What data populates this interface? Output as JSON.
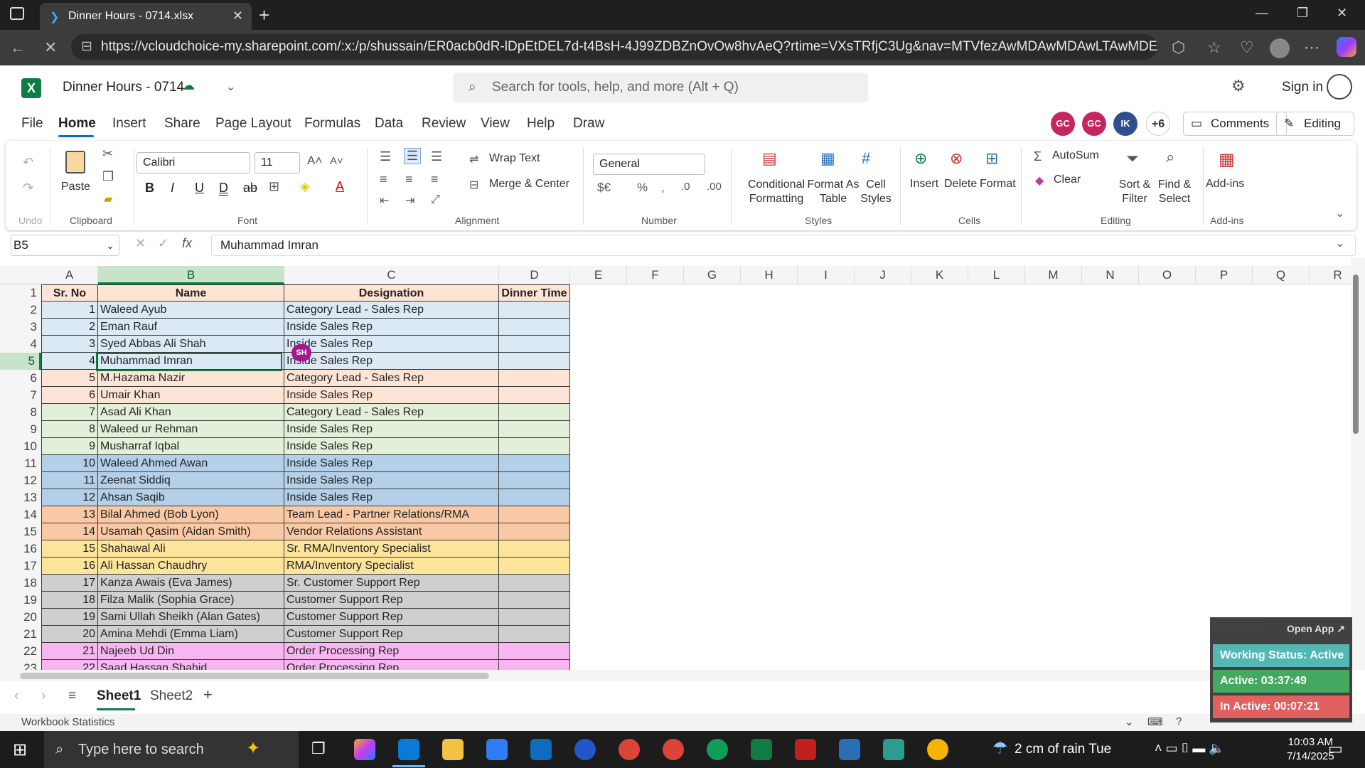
{
  "browser": {
    "tab_title": "Dinner Hours - 0714.xlsx",
    "url": "https://vcloudchoice-my.sharepoint.com/:x:/p/shussain/ER0acb0dR-lDpEtDEL7d-t4BsH-4J99ZDBZnOvOw8hvAeQ?rtime=VXsTRfjC3Ug&nav=MTVfezAwMDAwMDAwLTAwMDEtMDA..."
  },
  "excel": {
    "doc_title": "Dinner Hours - 0714",
    "search_placeholder": "Search for tools, help, and more (Alt + Q)",
    "sign_in": "Sign in",
    "menu": [
      "File",
      "Home",
      "Insert",
      "Share",
      "Page Layout",
      "Formulas",
      "Data",
      "Review",
      "View",
      "Help",
      "Draw"
    ],
    "avatars": [
      {
        "label": "GC",
        "color": "#c4265e"
      },
      {
        "label": "GC",
        "color": "#c4265e"
      },
      {
        "label": "IK",
        "color": "#2d4f8f"
      }
    ],
    "more_count": "+6",
    "comments_label": "Comments",
    "editing_label": "Editing",
    "ribbon": {
      "undo_group": "Undo",
      "clipboard_group": "Clipboard",
      "paste_label": "Paste",
      "font_group": "Font",
      "font_name": "Calibri",
      "font_size": "11",
      "alignment_group": "Alignment",
      "wrap_text": "Wrap Text",
      "merge_center": "Merge & Center",
      "number_group": "Number",
      "number_format": "General",
      "styles_group": "Styles",
      "conditional_formatting": [
        "Conditional",
        "Formatting"
      ],
      "format_as_table": [
        "Format As",
        "Table"
      ],
      "cell_styles": [
        "Cell",
        "Styles"
      ],
      "cells_group": "Cells",
      "insert": "Insert",
      "delete": "Delete",
      "format": "Format",
      "editing_group": "Editing",
      "autosum": "AutoSum",
      "clear": "Clear",
      "sort_filter": [
        "Sort &",
        "Filter"
      ],
      "find_select": [
        "Find &",
        "Select"
      ],
      "addins_group": "Add-ins",
      "addins": "Add-ins"
    },
    "name_box": "B5",
    "formula_value": "Muhammad Imran",
    "columns": [
      "A",
      "B",
      "C",
      "D",
      "E",
      "F",
      "G",
      "H",
      "I",
      "J",
      "K",
      "L",
      "M",
      "N",
      "O",
      "P",
      "Q",
      "R"
    ],
    "headers": [
      "Sr. No",
      "Name",
      "Designation",
      "Dinner Time"
    ],
    "rows": [
      {
        "n": "1",
        "name": "Waleed Ayub",
        "designation": "Category Lead - Sales Rep",
        "color": "#dbe9f5"
      },
      {
        "n": "2",
        "name": "Eman Rauf",
        "designation": "Inside Sales Rep",
        "color": "#dbe9f5"
      },
      {
        "n": "3",
        "name": "Syed Abbas Ali Shah",
        "designation": "Inside Sales Rep",
        "color": "#dbe9f5"
      },
      {
        "n": "4",
        "name": "Muhammad Imran",
        "designation": "Inside Sales Rep",
        "color": "#dbe9f5"
      },
      {
        "n": "5",
        "name": "M.Hazama Nazir",
        "designation": "Category Lead - Sales Rep",
        "color": "#fde4d4"
      },
      {
        "n": "6",
        "name": "Umair Khan",
        "designation": "Inside Sales Rep",
        "color": "#fde4d4"
      },
      {
        "n": "7",
        "name": "Asad Ali Khan",
        "designation": "Category Lead - Sales Rep",
        "color": "#e2efd9"
      },
      {
        "n": "8",
        "name": "Waleed ur Rehman",
        "designation": "Inside Sales Rep",
        "color": "#e2efd9"
      },
      {
        "n": "9",
        "name": "Musharraf Iqbal",
        "designation": "Inside Sales Rep",
        "color": "#e2efd9"
      },
      {
        "n": "10",
        "name": "Waleed Ahmed Awan",
        "designation": "Inside Sales Rep",
        "color": "#b4cfe8"
      },
      {
        "n": "11",
        "name": "Zeenat Siddiq",
        "designation": "Inside Sales Rep",
        "color": "#b4cfe8"
      },
      {
        "n": "12",
        "name": "Ahsan Saqib",
        "designation": "Inside Sales Rep",
        "color": "#b4cfe8"
      },
      {
        "n": "13",
        "name": "Bilal Ahmed (Bob Lyon)",
        "designation": "Team Lead - Partner Relations/RMA",
        "color": "#f8c9a4"
      },
      {
        "n": "14",
        "name": "Usamah Qasim (Aidan Smith)",
        "designation": "Vendor Relations Assistant",
        "color": "#f8c9a4"
      },
      {
        "n": "15",
        "name": "Shahawal Ali",
        "designation": "Sr. RMA/Inventory Specialist",
        "color": "#fde49b"
      },
      {
        "n": "16",
        "name": "Ali Hassan Chaudhry",
        "designation": "RMA/Inventory Specialist",
        "color": "#fde49b"
      },
      {
        "n": "17",
        "name": "Kanza Awais (Eva James)",
        "designation": "Sr. Customer Support Rep",
        "color": "#cfcfcf"
      },
      {
        "n": "18",
        "name": "Filza Malik (Sophia Grace)",
        "designation": "Customer Support Rep",
        "color": "#cfcfcf"
      },
      {
        "n": "19",
        "name": "Sami Ullah Sheikh (Alan Gates)",
        "designation": "Customer Support Rep",
        "color": "#cfcfcf"
      },
      {
        "n": "20",
        "name": "Amina Mehdi (Emma Liam)",
        "designation": "Customer Support Rep",
        "color": "#cfcfcf"
      },
      {
        "n": "21",
        "name": "Najeeb Ud Din",
        "designation": "Order Processing Rep",
        "color": "#f7b6f0"
      },
      {
        "n": "22",
        "name": "Saad Hassan Shahid",
        "designation": "Order Processing Rep",
        "color": "#f7b6f0"
      }
    ],
    "header_color": "#fde4d4",
    "cursor_badge": "SH",
    "sheets": [
      "Sheet1",
      "Sheet2"
    ],
    "status_text": "Workbook Statistics"
  },
  "tracker": {
    "open_app": "Open App ↗",
    "working_status": "Working Status: Active",
    "active": "Active: 03:37:49",
    "inactive": "In Active: 00:07:21"
  },
  "taskbar": {
    "search_placeholder": "Type here to search",
    "weather": "2 cm of rain Tue",
    "time": "10:03 AM",
    "date": "7/14/2025"
  }
}
